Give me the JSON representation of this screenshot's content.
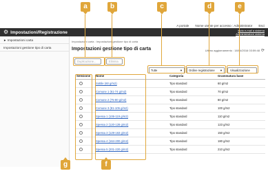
{
  "topbar": {
    "portal": "A portale",
    "user": "Nome utente per accesso : Administrator",
    "logout": "Esci"
  },
  "titlebar": {
    "title": "Impostazioni/Registrazione",
    "link1": "Invia e-mail a sistema",
    "link2": "Amministratore sistema"
  },
  "sidebar": {
    "items": [
      {
        "label": "Impostazioni carta"
      },
      {
        "label": "Impostazioni gestione tipo di carta"
      }
    ]
  },
  "breadcrumb": "Impostazioni carta : Impostazioni gestione tipo di carta",
  "page_title": "Impostazioni gestione tipo di carta",
  "updated": {
    "label": "Ultimo aggiornamento : 18/04/2016 03:59:48",
    "icon": "refresh-icon"
  },
  "buttons": {
    "duplicate": "Duplicazione...",
    "delete": "Elimina",
    "view_settings": "Visualizzazione"
  },
  "filters": {
    "type_value": "Tutte",
    "order_value": "Ordine registrazione"
  },
  "table": {
    "headers": {
      "select": "Selezione",
      "name": "Nome",
      "category": "Categoria",
      "grammage": "Grammatura base"
    },
    "rows": [
      {
        "name": "Sottile (60 g/m2)",
        "category": "Tipo standard",
        "grammage": "60 g/m2"
      },
      {
        "name": "Comune 1 (61-74 g/m2)",
        "category": "Tipo standard",
        "grammage": "70 g/m2"
      },
      {
        "name": "Comune 2 (75-80 g/m2)",
        "category": "Tipo standard",
        "grammage": "80 g/m2"
      },
      {
        "name": "Comune 3 (81-105 g/m2)",
        "category": "Tipo standard",
        "grammage": "100 g/m2"
      },
      {
        "name": "Spessa 1 (106-119 g/m2)",
        "category": "Tipo standard",
        "grammage": "110 g/m2"
      },
      {
        "name": "Spessa 2 (120-128 g/m2)",
        "category": "Tipo standard",
        "grammage": "123 g/m2"
      },
      {
        "name": "Spessa 3 (129-163 g/m2)",
        "category": "Tipo standard",
        "grammage": "150 g/m2"
      },
      {
        "name": "Spessa 4 (164-200 g/m2)",
        "category": "Tipo standard",
        "grammage": "180 g/m2"
      },
      {
        "name": "Spessa 5 (201-220 g/m2)",
        "category": "Tipo standard",
        "grammage": "210 g/m2"
      }
    ]
  },
  "callouts": [
    "a",
    "b",
    "c",
    "d",
    "e",
    "f",
    "g"
  ]
}
